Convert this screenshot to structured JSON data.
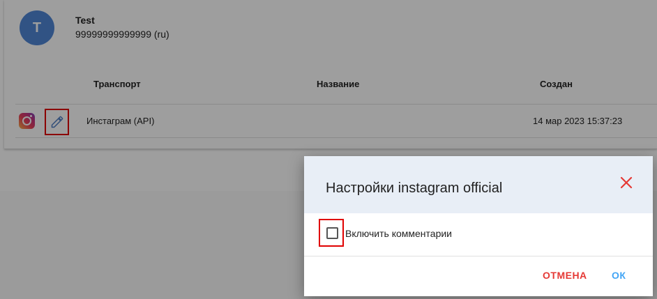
{
  "user": {
    "avatar_letter": "T",
    "name": "Test",
    "phone": "99999999999999 (ru)"
  },
  "table": {
    "headers": [
      "Транспорт",
      "Название",
      "Создан"
    ],
    "rows": [
      {
        "icon": "instagram-icon",
        "transport": "Инстаграм (API)",
        "name": "",
        "created": "14 мар 2023 15:37:23"
      }
    ]
  },
  "dialog": {
    "title": "Настройки instagram official",
    "checkbox_label": "Включить комментарии",
    "checkbox_checked": false,
    "cancel_label": "ОТМЕНА",
    "ok_label": "ОК"
  },
  "colors": {
    "accent": "#42a5f5",
    "danger": "#e53935",
    "avatar": "#4f86d6",
    "dialog_header": "#e8eef6"
  }
}
